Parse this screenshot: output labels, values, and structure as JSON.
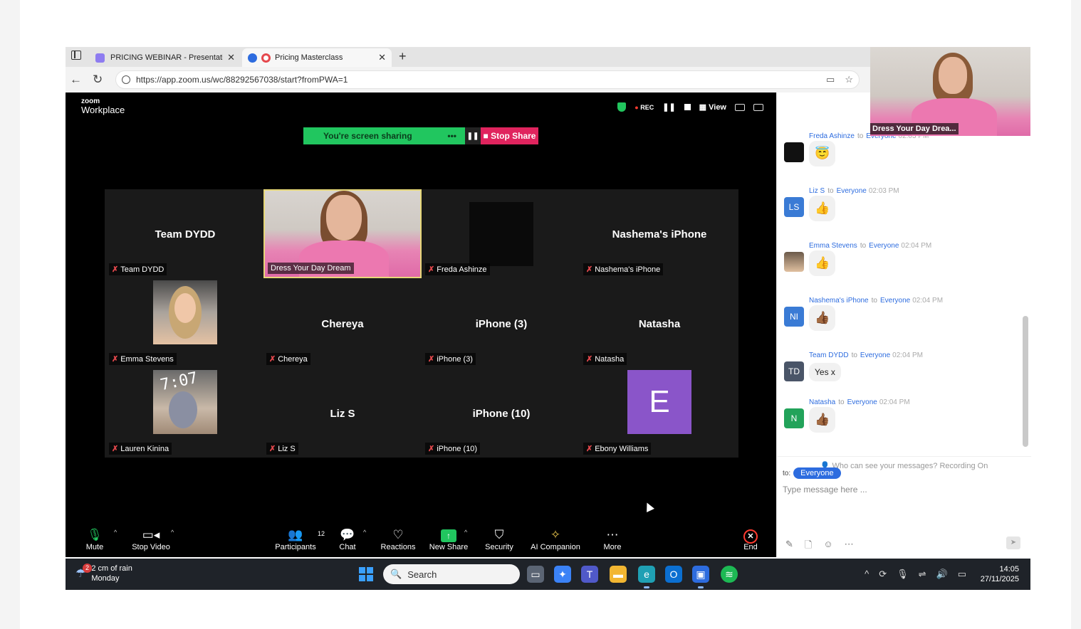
{
  "browser": {
    "tabs": [
      {
        "label": "PRICING WEBINAR - Presentation",
        "active": false
      },
      {
        "label": "Pricing Masterclass",
        "active": true
      }
    ],
    "url": "https://app.zoom.us/wc/88292567038/start?fromPWA=1"
  },
  "zoom": {
    "logo_top": "zoom",
    "logo_bottom": "Workplace",
    "rec_label": "REC",
    "view_label": "View",
    "sharing_label": "You're screen sharing",
    "stop_share_label": "Stop Share",
    "tiles": [
      {
        "center": "Team DYDD",
        "label": "Team DYDD",
        "kind": "name"
      },
      {
        "center": "",
        "label": "Dress Your Day Dream",
        "kind": "video-pink"
      },
      {
        "center": "",
        "label": "Freda Ashinze",
        "kind": "dark"
      },
      {
        "center": "Nashema's iPhone",
        "label": "Nashema's iPhone",
        "kind": "name"
      },
      {
        "center": "",
        "label": "Emma Stevens",
        "kind": "video-emma"
      },
      {
        "center": "Chereya",
        "label": "Chereya",
        "kind": "name"
      },
      {
        "center": "iPhone (3)",
        "label": "iPhone (3)",
        "kind": "name"
      },
      {
        "center": "Natasha",
        "label": "Natasha",
        "kind": "name"
      },
      {
        "center": "",
        "label": "Lauren Kinina",
        "kind": "video-lauren",
        "overlay": "7:07"
      },
      {
        "center": "Liz S",
        "label": "Liz S",
        "kind": "name"
      },
      {
        "center": "iPhone (10)",
        "label": "iPhone (10)",
        "kind": "name"
      },
      {
        "center": "",
        "label": "Ebony Williams",
        "kind": "avatar",
        "avatar_letter": "E"
      }
    ],
    "toolbar": {
      "mute": "Mute",
      "stop_video": "Stop Video",
      "participants": "Participants",
      "participants_count": "12",
      "chat": "Chat",
      "reactions": "Reactions",
      "new_share": "New Share",
      "security": "Security",
      "ai_companion": "AI Companion",
      "more": "More",
      "end": "End"
    }
  },
  "self_view": {
    "name": "Dress Your Day Drea..."
  },
  "chat": {
    "messages": [
      {
        "from": "Freda Ashinze",
        "to": "Everyone",
        "time": "02:03 PM",
        "avatar": "",
        "avatar_color": "#111111",
        "content": "😇",
        "type": "emoji"
      },
      {
        "from": "Liz S",
        "to": "Everyone",
        "time": "02:03 PM",
        "avatar": "LS",
        "avatar_color": "#3a7bd5",
        "content": "👍",
        "type": "emoji"
      },
      {
        "from": "Emma Stevens",
        "to": "Everyone",
        "time": "02:04 PM",
        "avatar": "",
        "avatar_color": "#b89a7a",
        "content": "👍",
        "type": "emoji"
      },
      {
        "from": "Nashema's iPhone",
        "to": "Everyone",
        "time": "02:04 PM",
        "avatar": "NI",
        "avatar_color": "#3a7bd5",
        "content": "👍🏾",
        "type": "emoji"
      },
      {
        "from": "Team DYDD",
        "to": "Everyone",
        "time": "02:04 PM",
        "avatar": "TD",
        "avatar_color": "#4a5568",
        "content": "Yes x",
        "type": "text"
      },
      {
        "from": "Natasha",
        "to": "Everyone",
        "time": "02:04 PM",
        "avatar": "N",
        "avatar_color": "#22a35a",
        "content": "👍🏾",
        "type": "emoji"
      }
    ],
    "to_word": "to",
    "visibility_note": "Who can see your messages? Recording On",
    "to_label": "to:",
    "recipient": "Everyone",
    "input_placeholder": "Type message here ..."
  },
  "taskbar": {
    "weather_line1": "2 cm of rain",
    "weather_line2": "Monday",
    "notification_count": "2",
    "search_label": "Search",
    "time": "14:05",
    "date": "27/11/2025"
  }
}
